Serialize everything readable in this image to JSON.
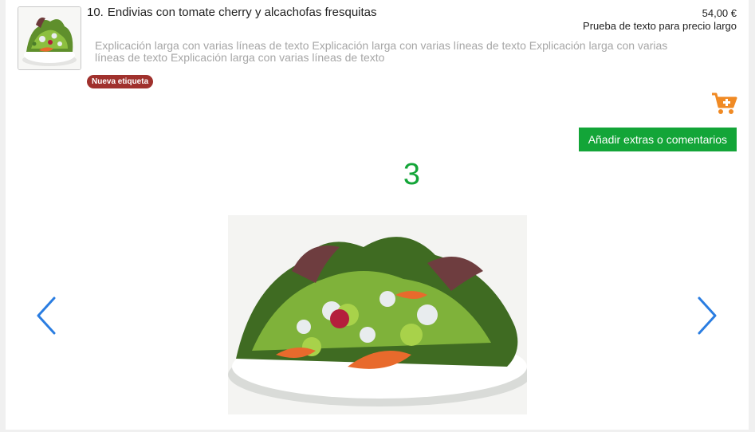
{
  "product": {
    "number": "10.",
    "name": "Endivias con tomate cherry y alcachofas fresquitas",
    "price": "54,00 €",
    "price_note": "Prueba de texto para precio largo",
    "description": "Explicación larga con varias líneas de texto Explicación larga con varias líneas de texto Explicación larga con varias líneas de texto Explicación larga con varias líneas de texto",
    "tag": "Nueva etiqueta"
  },
  "actions": {
    "extras_label": "Añadir extras o comentarios",
    "cart_icon": "cart-plus-icon"
  },
  "gallery": {
    "counter": "3",
    "prev_icon": "chevron-left-icon",
    "next_icon": "chevron-right-icon"
  },
  "colors": {
    "accent_green": "#13a538",
    "cart_orange": "#f08a24",
    "tag_red": "#a0312d",
    "arrow_blue": "#2a7de1"
  }
}
